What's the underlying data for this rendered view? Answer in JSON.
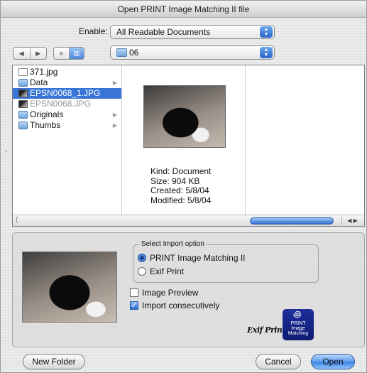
{
  "window": {
    "title": "Open PRINT Image Matching II file"
  },
  "enable": {
    "label": "Enable:",
    "value": "All Readable Documents"
  },
  "nav": {
    "back_icon": "back-arrow-icon",
    "forward_icon": "forward-arrow-icon",
    "list_view_icon": "list-view-icon",
    "column_view_icon": "column-view-icon"
  },
  "location": {
    "value": "06"
  },
  "files": [
    {
      "name": "371.jpg",
      "kind": "file",
      "selected": false,
      "dim": false,
      "folder": false
    },
    {
      "name": "Data",
      "kind": "folder",
      "selected": false,
      "dim": false,
      "folder": true
    },
    {
      "name": "EPSN0068_1.JPG",
      "kind": "photo",
      "selected": true,
      "dim": false,
      "folder": false
    },
    {
      "name": "EPSN0068.JPG",
      "kind": "photo",
      "selected": false,
      "dim": true,
      "folder": false
    },
    {
      "name": "Originals",
      "kind": "folder",
      "selected": false,
      "dim": false,
      "folder": true
    },
    {
      "name": "Thumbs",
      "kind": "folder",
      "selected": false,
      "dim": false,
      "folder": true
    }
  ],
  "preview": {
    "kind": "Kind: Document",
    "size": "Size: 904 KB",
    "created": "Created: 5/8/04",
    "modified": "Modified: 5/8/04"
  },
  "import": {
    "group_title": "Select Import option",
    "option_pim": "PRINT Image Matching II",
    "option_exif": "Exif Print",
    "selected_option": "PRINT Image Matching II",
    "image_preview_label": "Image Preview",
    "image_preview_checked": false,
    "import_consecutively_label": "Import consecutively",
    "import_consecutively_checked": true
  },
  "logos": {
    "exif_print": "Exif Print",
    "pim_line1": "PRINT",
    "pim_line2": "Image",
    "pim_line3": "Matching"
  },
  "buttons": {
    "new_folder": "New Folder",
    "cancel": "Cancel",
    "open": "Open"
  },
  "colors": {
    "selection": "#3875d7",
    "default_button": "#3a82e6",
    "pim_logo": "#1d2f99"
  }
}
